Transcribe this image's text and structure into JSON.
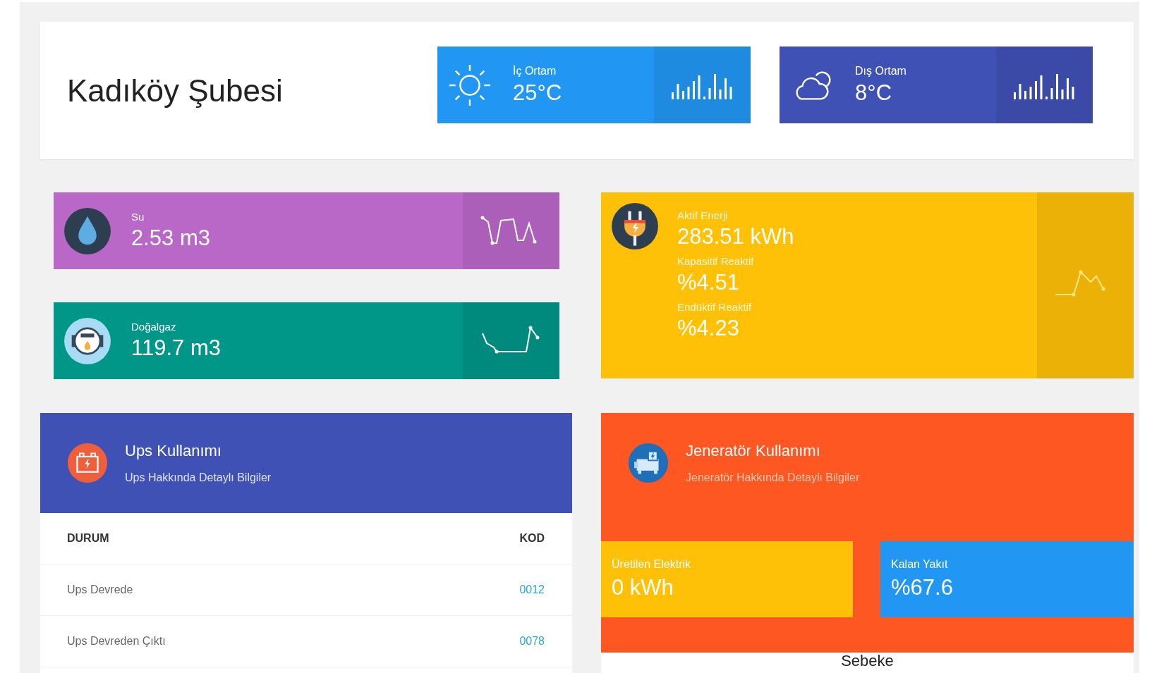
{
  "header": {
    "title": "Kadıköy Şubesi"
  },
  "weather": [
    {
      "kind": "sun",
      "label": "İç Ortam",
      "value": "25°C"
    },
    {
      "kind": "cloud",
      "label": "Dış Ortam",
      "value": "8°C"
    }
  ],
  "meters": [
    {
      "kind": "water",
      "label": "Su",
      "value": "2.53 m3"
    },
    {
      "kind": "gas",
      "label": "Doğalgaz",
      "value": "119.7 m3"
    }
  ],
  "energy": {
    "readings": [
      {
        "label": "Aktif Enerji",
        "value": "283.51 kWh"
      },
      {
        "label": "Kapasitif Reaktif",
        "value": "%4.51"
      },
      {
        "label": "Endüktif Reaktif",
        "value": "%4.23"
      }
    ]
  },
  "ups": {
    "title": "Ups Kullanımı",
    "subtitle": "Ups Hakkında Detaylı Bilgiler",
    "table": {
      "columns": [
        "DURUM",
        "KOD"
      ],
      "rows": [
        [
          "Ups Devrede",
          "0012"
        ],
        [
          "Ups Devreden Çıktı",
          "0078"
        ]
      ]
    }
  },
  "generator": {
    "title": "Jeneratör Kullanımı",
    "subtitle": "Jeneratör Hakkında Detaylı Bilgiler",
    "stats": [
      {
        "kind": "produced",
        "label": "Üretilen Elektrik",
        "value": "0 kWh"
      },
      {
        "kind": "fuel",
        "label": "Kalan Yakıt",
        "value": "%67.6"
      }
    ],
    "footer": "Sebeke"
  }
}
